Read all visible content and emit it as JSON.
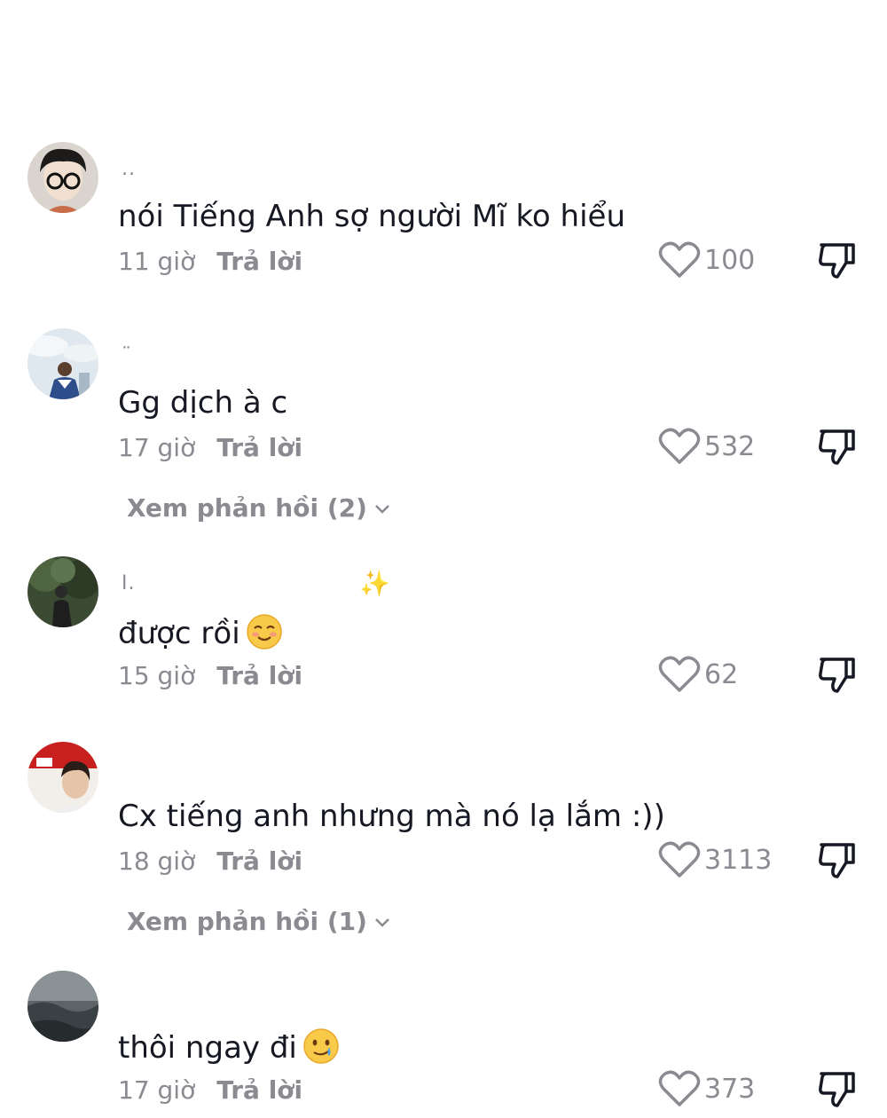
{
  "comments": [
    {
      "username": "..",
      "text": "nói Tiếng Anh sợ người Mĩ ko hiểu",
      "time": "11 giờ",
      "reply_label": "Trả lời",
      "likes": "100",
      "avatar_icon": "avatar-boy-glasses"
    },
    {
      "username": "¨",
      "text": "Gg dịch à c",
      "time": "17 giờ",
      "reply_label": "Trả lời",
      "likes": "532",
      "view_replies": "Xem phản hồi (2)",
      "avatar_icon": "avatar-sky-person"
    },
    {
      "username": "I.",
      "text": "được rồi",
      "emoji": "smiling-face-icon",
      "time": "15 giờ",
      "reply_label": "Trả lời",
      "likes": "62",
      "avatar_icon": "avatar-tree-person"
    },
    {
      "username": "",
      "text": "Cx tiếng anh nhưng mà nó lạ lắm :))",
      "time": "18 giờ",
      "reply_label": "Trả lời",
      "likes": "3113",
      "view_replies": "Xem phản hồi (1)",
      "avatar_icon": "avatar-young-man-red"
    },
    {
      "username": "",
      "text": "thôi ngay đi",
      "emoji": "smiling-tear-face-icon",
      "time": "17 giờ",
      "reply_label": "Trả lời",
      "likes": "373",
      "avatar_icon": "avatar-dark-landscape"
    }
  ],
  "colors": {
    "text": "#161823",
    "muted": "#8a8b91",
    "background": "#ffffff"
  }
}
